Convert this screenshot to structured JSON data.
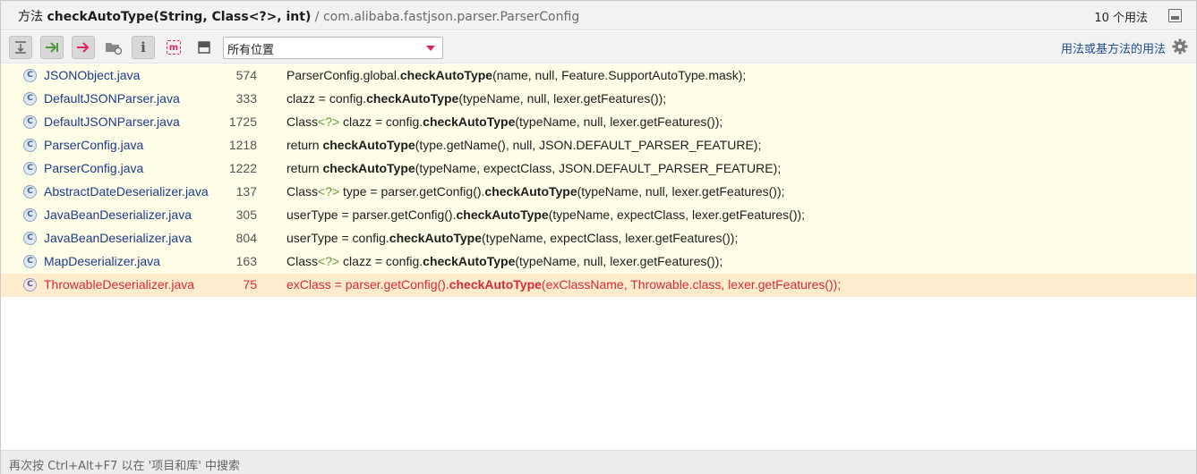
{
  "titlebar": {
    "prefix": "方法",
    "signature": "checkAutoType(String, Class<?>, int)",
    "separator": "/",
    "package": "com.alibaba.fastjson.parser.ParserConfig",
    "count": "10 个用法"
  },
  "toolbar": {
    "scope_value": "所有位置",
    "usages_link": "用法或基方法的用法"
  },
  "results": [
    {
      "file": "JSONObject.java",
      "line": "574",
      "pre": "ParserConfig.global.",
      "method": "checkAutoType",
      "post": "(name, null, Feature.SupportAutoType.mask);",
      "generic": ""
    },
    {
      "file": "DefaultJSONParser.java",
      "line": "333",
      "pre": "clazz = config.",
      "method": "checkAutoType",
      "post": "(typeName, null, lexer.getFeatures());",
      "generic": ""
    },
    {
      "file": "DefaultJSONParser.java",
      "line": "1725",
      "pre": "Class",
      "generic": "<?>",
      "pre2": " clazz = config.",
      "method": "checkAutoType",
      "post": "(typeName, null, lexer.getFeatures());"
    },
    {
      "file": "ParserConfig.java",
      "line": "1218",
      "pre": "return ",
      "method": "checkAutoType",
      "post": "(type.getName(), null, JSON.DEFAULT_PARSER_FEATURE);",
      "generic": ""
    },
    {
      "file": "ParserConfig.java",
      "line": "1222",
      "pre": "return ",
      "method": "checkAutoType",
      "post": "(typeName, expectClass, JSON.DEFAULT_PARSER_FEATURE);",
      "generic": ""
    },
    {
      "file": "AbstractDateDeserializer.java",
      "line": "137",
      "pre": "Class",
      "generic": "<?>",
      "pre2": " type = parser.getConfig().",
      "method": "checkAutoType",
      "post": "(typeName, null, lexer.getFeatures());"
    },
    {
      "file": "JavaBeanDeserializer.java",
      "line": "305",
      "pre": "userType = parser.getConfig().",
      "method": "checkAutoType",
      "post": "(typeName, expectClass, lexer.getFeatures());",
      "generic": ""
    },
    {
      "file": "JavaBeanDeserializer.java",
      "line": "804",
      "pre": "userType = config.",
      "method": "checkAutoType",
      "post": "(typeName, expectClass, lexer.getFeatures());",
      "generic": ""
    },
    {
      "file": "MapDeserializer.java",
      "line": "163",
      "pre": "Class",
      "generic": "<?>",
      "pre2": " clazz = config.",
      "method": "checkAutoType",
      "post": "(typeName, null, lexer.getFeatures());"
    },
    {
      "file": "ThrowableDeserializer.java",
      "line": "75",
      "pre": "exClass = parser.getConfig().",
      "method": "checkAutoType",
      "post": "(exClassName, Throwable.class, lexer.getFeatures());",
      "generic": "",
      "selected": true
    }
  ],
  "status": {
    "hint": "再次按 Ctrl+Alt+F7 以在 '项目和库' 中搜索"
  },
  "icons": {
    "class_icon_letter": "C",
    "info_icon_letter": "i",
    "m_icon_letter": "m"
  },
  "colors": {
    "accent": "#e0245e",
    "row_bg": "#fdfde8",
    "selected_bg": "#ffeccc",
    "selected_text": "#d8283c"
  }
}
